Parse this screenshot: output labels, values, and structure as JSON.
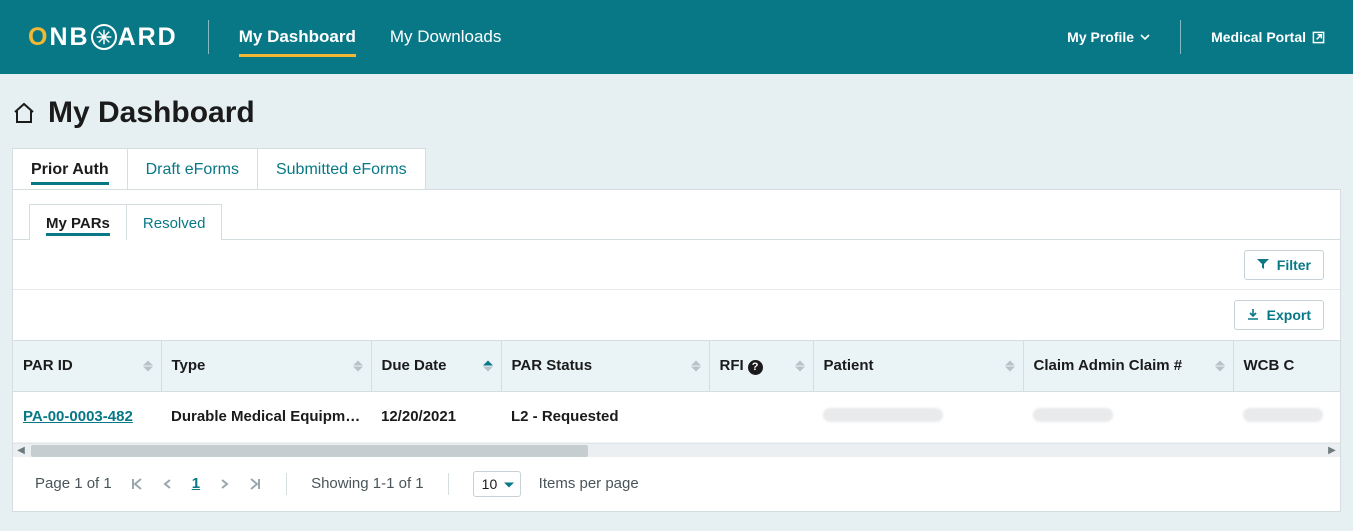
{
  "brand": {
    "part1": "O",
    "part2": "NB",
    "part3": "ARD"
  },
  "nav": {
    "items": [
      {
        "label": "My Dashboard"
      },
      {
        "label": "My Downloads"
      }
    ],
    "profile_label": "My Profile",
    "portal_label": "Medical Portal"
  },
  "page": {
    "title": "My Dashboard",
    "tabs": [
      {
        "label": "Prior Auth"
      },
      {
        "label": "Draft eForms"
      },
      {
        "label": "Submitted eForms"
      }
    ],
    "subtabs": [
      {
        "label": "My PARs"
      },
      {
        "label": "Resolved"
      }
    ]
  },
  "toolbar": {
    "filter_label": "Filter",
    "export_label": "Export"
  },
  "table": {
    "columns": [
      "PAR ID",
      "Type",
      "Due Date",
      "PAR Status",
      "RFI",
      "Patient",
      "Claim Admin Claim #",
      "WCB C"
    ],
    "rows": [
      {
        "par_id": "PA-00-0003-482",
        "type": "Durable Medical Equipmen",
        "due_date": "12/20/2021",
        "par_status": "L2 - Requested",
        "rfi": "",
        "patient": "",
        "claim": "",
        "wcb": ""
      }
    ]
  },
  "pager": {
    "page_text": "Page 1 of 1",
    "current_page": "1",
    "showing_text": "Showing 1-1 of 1",
    "per_page_value": "10",
    "per_page_label": "Items per page"
  }
}
